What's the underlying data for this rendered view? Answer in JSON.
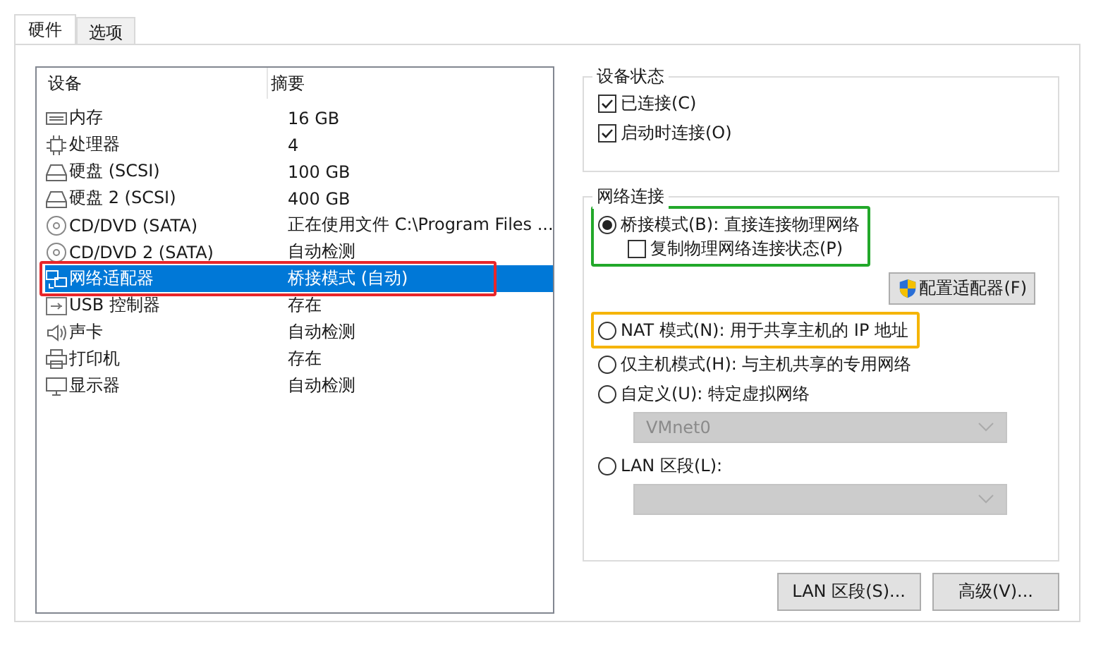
{
  "tabs": [
    {
      "label": "硬件",
      "selected": true
    },
    {
      "label": "选项",
      "selected": false
    }
  ],
  "devices": {
    "columns": [
      "设备",
      "摘要"
    ],
    "rows": [
      {
        "kind": "memory",
        "name": "内存",
        "summary": "16 GB",
        "selected": false
      },
      {
        "kind": "cpu",
        "name": "处理器",
        "summary": "4",
        "selected": false
      },
      {
        "kind": "disk",
        "name": "硬盘 (SCSI)",
        "summary": "100 GB",
        "selected": false
      },
      {
        "kind": "disk",
        "name": "硬盘 2 (SCSI)",
        "summary": "400 GB",
        "selected": false
      },
      {
        "kind": "cd",
        "name": "CD/DVD (SATA)",
        "summary": "正在使用文件 C:\\Program Files ...",
        "selected": false
      },
      {
        "kind": "cd",
        "name": "CD/DVD 2 (SATA)",
        "summary": "自动检测",
        "selected": false
      },
      {
        "kind": "network",
        "name": "网络适配器",
        "summary": "桥接模式 (自动)",
        "selected": true,
        "color": "#e8262a"
      },
      {
        "kind": "usb",
        "name": "USB 控制器",
        "summary": "存在",
        "selected": false
      },
      {
        "kind": "sound",
        "name": "声卡",
        "summary": "自动检测",
        "selected": false
      },
      {
        "kind": "printer",
        "name": "打印机",
        "summary": "存在",
        "selected": false
      },
      {
        "kind": "display",
        "name": "显示器",
        "summary": "自动检测",
        "selected": false
      }
    ]
  },
  "device_status": {
    "title": "设备状态",
    "checkboxes": [
      {
        "label": "已连接(C)",
        "checked": true
      },
      {
        "label": "启动时连接(O)",
        "checked": true
      }
    ]
  },
  "network_connection": {
    "title": "网络连接",
    "options": [
      {
        "label": "桥接模式(B): 直接连接物理网络",
        "selected": true,
        "color": "#22a82a",
        "sub_option": {
          "label": "复制物理网络连接状态(P)",
          "checked": false
        },
        "button": "配置适配器(F)"
      },
      {
        "label": "NAT 模式(N): 用于共享主机的 IP 地址",
        "selected": false,
        "color": "#f5b400"
      },
      {
        "label": "仅主机模式(H): 与主机共享的专用网络",
        "selected": false
      },
      {
        "label": "自定义(U): 特定虚拟网络",
        "selected": false,
        "dropdown": {
          "value": "VMnet0",
          "disabled": true
        }
      },
      {
        "label": "LAN 区段(L):",
        "selected": false,
        "dropdown": {
          "disabled": true
        }
      }
    ]
  },
  "buttons": [
    "LAN 区段(S)...",
    "高级(V)..."
  ]
}
